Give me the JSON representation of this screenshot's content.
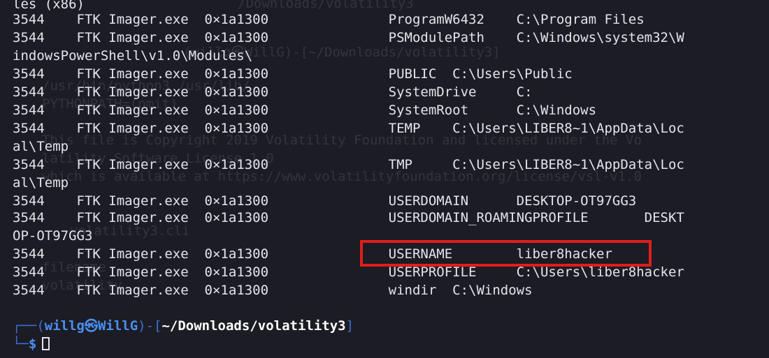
{
  "terminal": {
    "background_ghost_text": [
      "/Downloads/volatility3",
      "(willg㉿WillG)-[~/Downloads/volatility3]",
      "/usr/bin/python3 /usr/lib/",
      "PYTHONPATH=(omit)",
      "This file is Copyright 2019 Volatility Foundation and licensed under the Vo",
      "latility Software License 1.0",
      "which is available at https://www.volatilityfoundation.org/license/vsl-v1.0",
      "volatility3.cli",
      "filename",
      "volatility"
    ],
    "lines": [
      {
        "text": "les (x86)"
      },
      {
        "text": "3544    FTK Imager.exe  0×1a1300               ProgramW6432    C:\\Program Files"
      },
      {
        "text": "3544    FTK Imager.exe  0×1a1300               PSModulePath    C:\\Windows\\system32\\W"
      },
      {
        "text": "indowsPowerShell\\v1.0\\Modules\\"
      },
      {
        "text": "3544    FTK Imager.exe  0×1a1300               PUBLIC  C:\\Users\\Public"
      },
      {
        "text": "3544    FTK Imager.exe  0×1a1300               SystemDrive     C:"
      },
      {
        "text": "3544    FTK Imager.exe  0×1a1300               SystemRoot      C:\\Windows"
      },
      {
        "text": "3544    FTK Imager.exe  0×1a1300               TEMP    C:\\Users\\LIBER8~1\\AppData\\Loc"
      },
      {
        "text": "al\\Temp"
      },
      {
        "text": "3544    FTK Imager.exe  0×1a1300               TMP     C:\\Users\\LIBER8~1\\AppData\\Loc"
      },
      {
        "text": "al\\Temp"
      },
      {
        "text": "3544    FTK Imager.exe  0×1a1300               USERDOMAIN      DESKTOP-OT97GG3"
      },
      {
        "text": "3544    FTK Imager.exe  0×1a1300               USERDOMAIN_ROAMINGPROFILE       DESKT"
      },
      {
        "text": "OP-OT97GG3"
      },
      {
        "text": "3544    FTK Imager.exe  0×1a1300               USERNAME        liber8hacker"
      },
      {
        "text": "3544    FTK Imager.exe  0×1a1300               USERPROFILE     C:\\Users\\liber8hacker"
      },
      {
        "text": "3544    FTK Imager.exe  0×1a1300               windir  C:\\Windows"
      }
    ],
    "prompt": {
      "corner_top": "┌──(",
      "user_host": "willg㉿WillG",
      "mid": ")-[",
      "path": "~/Downloads/volatility3",
      "close": "]",
      "corner_bottom": "└─",
      "dollar": "$"
    },
    "colors": {
      "background": "#1c1c24",
      "foreground": "#e4e4ec",
      "prompt_accent": "#4a8ff2",
      "highlight_box": "#e01d1d"
    }
  }
}
